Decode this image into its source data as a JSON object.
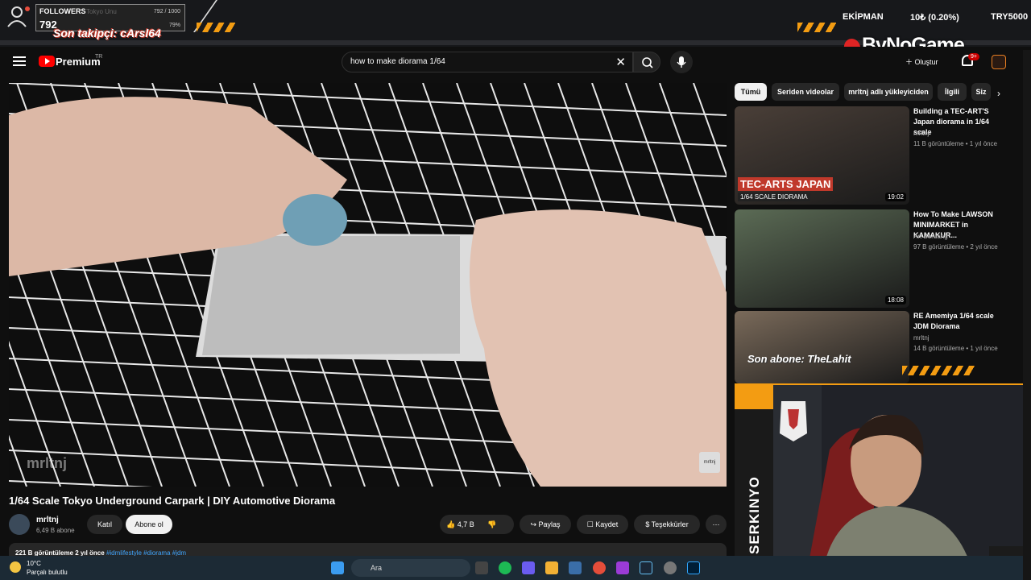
{
  "overlay": {
    "followers_label": "FOLLOWERS",
    "followers_sub": "Tokyo Unu",
    "followers_count": "792",
    "followers_goal": "792 / 1000",
    "followers_pct": "79%",
    "last_follower": "Son takipçi: cArsl64",
    "equipment_label": "EKİPMAN",
    "equipment_value": "10₺ (0.20%)",
    "equipment_goal": "TRY5000",
    "brand": "ByNoGame",
    "last_sub": "Son abone: TheLahit",
    "streamer_banner": "SERKINYO"
  },
  "masthead": {
    "logo_label": "Premium",
    "region": "TR",
    "search_query": "how to make diorama 1/64",
    "create_label": "Oluştur",
    "notif_badge": "9+"
  },
  "video": {
    "title": "1/64 Scale Tokyo Underground Carpark | DIY Automotive Diorama",
    "watermark": "mrltnj",
    "channel": "mrltnj",
    "subs": "6,49 B abone",
    "join": "Katıl",
    "subscribe": "Abone ol",
    "likes": "4,7 B",
    "share": "Paylaş",
    "save": "Kaydet",
    "thanks": "Teşekkürler",
    "desc_stats": "221 B görüntüleme  2 yıl önce",
    "desc_tags": "#idmlifestyle #diorama #jdm"
  },
  "chips": [
    "Tümü",
    "Seriden videolar",
    "mrltnj adlı yükleyiciden",
    "İlgili",
    "Siz"
  ],
  "recs": [
    {
      "title": "Building a TEC-ART'S Japan diorama in 1/64 scale",
      "channel": "mrltnj",
      "meta": "11 B görüntüleme • 1 yıl önce",
      "duration": "19:02",
      "thumb_text": "TEC-ARTS JAPAN",
      "thumb_sub": "1/64 SCALE DIORAMA",
      "thumb_color": "#4a3f38"
    },
    {
      "title": "How To Make LAWSON MINIMARKET in KAMAKUR...",
      "channel": "Art Beruang",
      "meta": "97 B görüntüleme • 2 yıl önce",
      "duration": "18:08",
      "thumb_text": "",
      "thumb_sub": "",
      "thumb_color": "#5b6b55"
    },
    {
      "title": "RE Amemiya 1/64 scale JDM Diorama",
      "channel": "mrltnj",
      "meta": "14 B görüntüleme • 1 yıl önce",
      "duration": "",
      "thumb_text": "",
      "thumb_sub": "",
      "thumb_color": "#7a6a5a"
    }
  ],
  "taskbar": {
    "temp": "10°C",
    "weather": "Parçalı bulutlu",
    "search": "Ara"
  }
}
